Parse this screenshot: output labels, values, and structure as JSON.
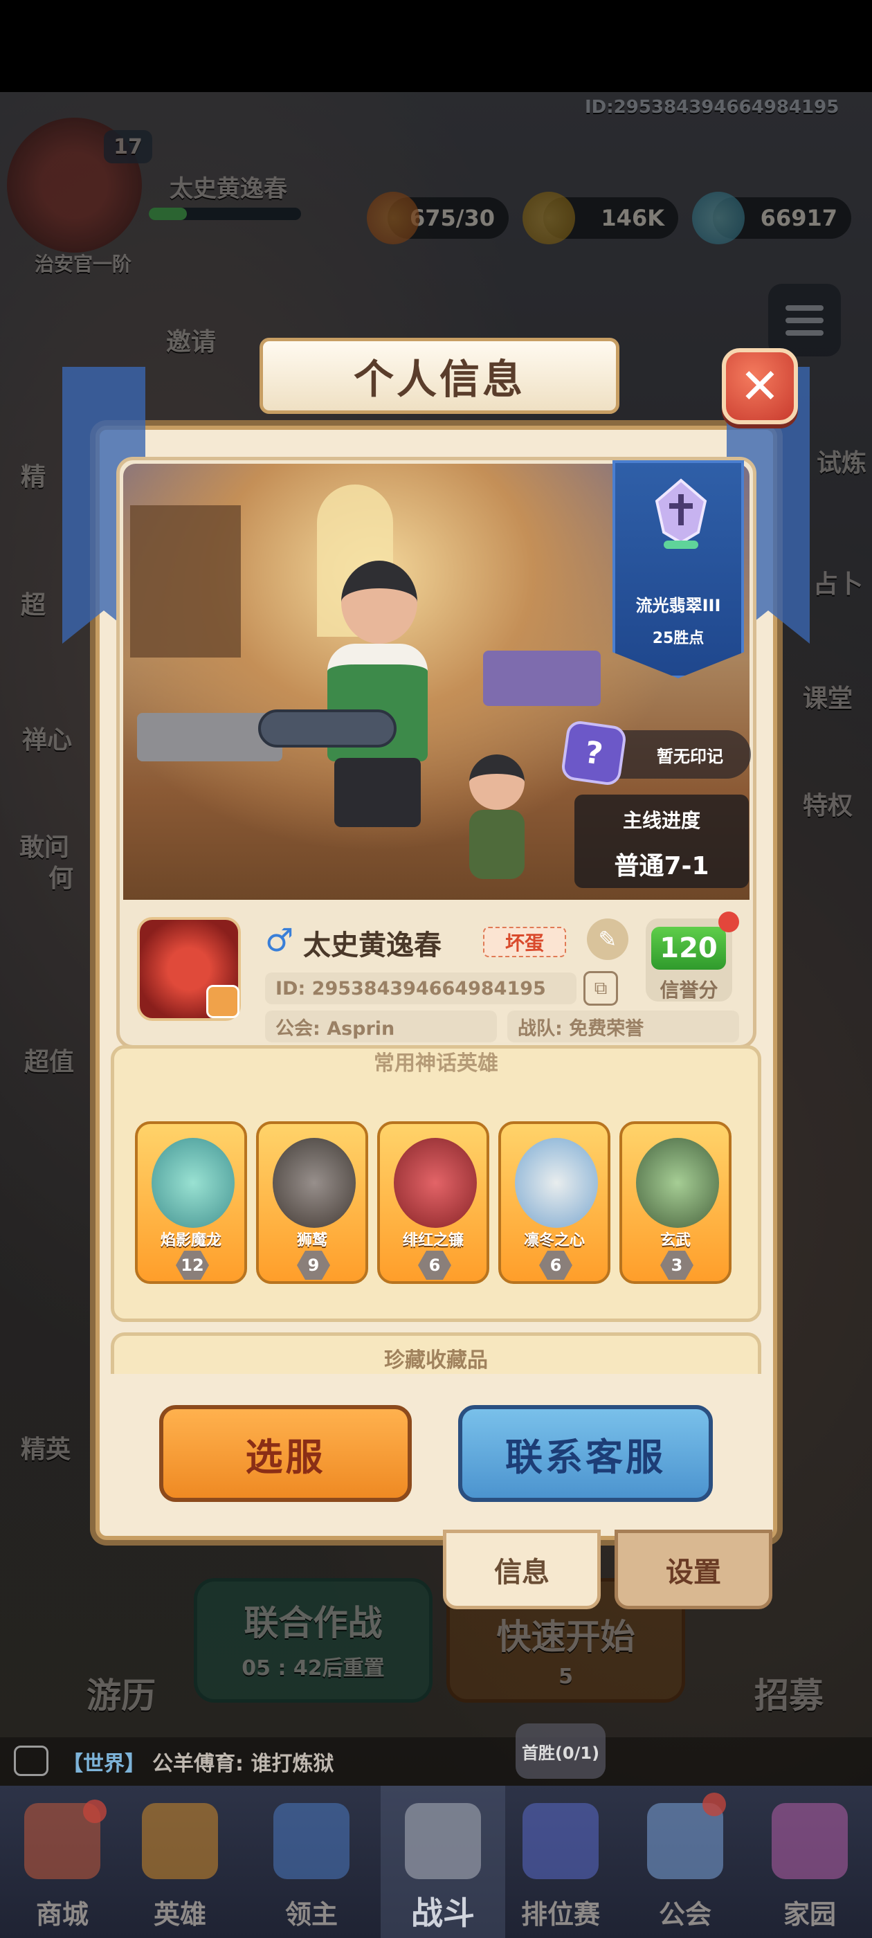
{
  "top_bar": {
    "account_id": "ID:29538439466498419​5",
    "player_level": "17",
    "player_name": "太史黄逸春",
    "rank_title": "治安官一阶",
    "resources": [
      {
        "icon": "stamina-icon",
        "value": "675/30"
      },
      {
        "icon": "gold-coin-icon",
        "value": "146K"
      },
      {
        "icon": "crystal-icon",
        "value": "66917"
      }
    ]
  },
  "background_labels": {
    "invite": "邀请",
    "left_side": [
      "精",
      "超",
      "禅心",
      "敢问",
      "何",
      "超值"
    ],
    "right_side": [
      "试炼",
      "占卜",
      "课堂",
      "特权"
    ],
    "elite": "精英",
    "joint_battle": "联合作战",
    "joint_timer": "05 : 42后重置",
    "quick_start": "快速开始",
    "quick_start_cost": "5",
    "travel": "游历",
    "recruit": "招募"
  },
  "modal": {
    "title": "个人信息",
    "rank": {
      "name": "流光翡翠III",
      "points": "25胜点"
    },
    "imprint": "暂无印记",
    "progress": {
      "label": "主线进度",
      "value": "普通7-1"
    },
    "profile": {
      "name": "太史黄逸春",
      "title_badge": "坏蛋",
      "id": "ID:  29538439466498419​5",
      "guild": "公会:  Asprin",
      "team": "战队:  免费荣誉",
      "credit_value": "120",
      "credit_label": "信誉分"
    },
    "heroes_title": "常用神话英雄",
    "heroes": [
      {
        "name": "焰影魔龙",
        "level": "12",
        "color": "#5bc6c6"
      },
      {
        "name": "狮鹫",
        "level": "9",
        "color": "#4b4a52"
      },
      {
        "name": "绯红之镰",
        "level": "6",
        "color": "#b8283a"
      },
      {
        "name": "凛冬之心",
        "level": "6",
        "color": "#9dc9f2"
      },
      {
        "name": "玄武",
        "level": "3",
        "color": "#4e7d58"
      }
    ],
    "collection_title": "珍藏收藏品",
    "buttons": {
      "select_server": "选服",
      "contact_support": "联系客服"
    },
    "tabs": {
      "info": "信息",
      "settings": "设置"
    }
  },
  "chat": {
    "channel": "【世界】",
    "message": "公羊傅育: 谁打炼狱",
    "first_win": "首胜(0/1)"
  },
  "nav": [
    {
      "label": "商城",
      "icon": "shop-icon",
      "color": "#c25a3c"
    },
    {
      "label": "英雄",
      "icon": "hero-card-icon",
      "color": "#d08a2a"
    },
    {
      "label": "领主",
      "icon": "lord-banner-icon",
      "color": "#4a79c0"
    },
    {
      "label": "战斗",
      "icon": "battle-swords-icon",
      "color": "#8a8f9c"
    },
    {
      "label": "排位赛",
      "icon": "ranked-shield-icon",
      "color": "#5a6ac8"
    },
    {
      "label": "公会",
      "icon": "guild-castle-icon",
      "color": "#7aa3d8"
    },
    {
      "label": "家园",
      "icon": "home-icon",
      "color": "#b45fa8"
    }
  ]
}
